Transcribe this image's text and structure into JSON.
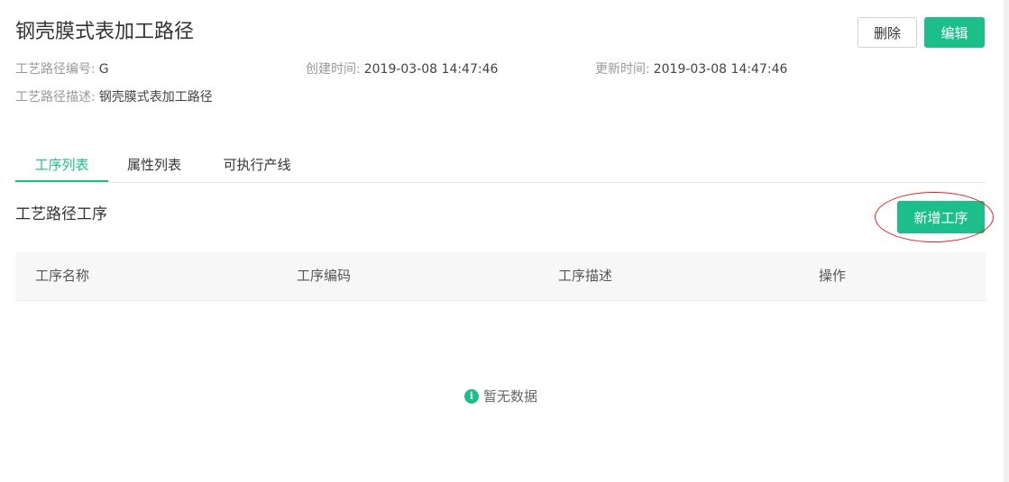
{
  "header": {
    "title": "钢壳膜式表加工路径",
    "delete_label": "删除",
    "edit_label": "编辑"
  },
  "meta": {
    "code_label": "工艺路径编号:",
    "code_value": "G",
    "created_label": "创建时间:",
    "created_value": "2019-03-08 14:47:46",
    "updated_label": "更新时间:",
    "updated_value": "2019-03-08 14:47:46",
    "desc_label": "工艺路径描述:",
    "desc_value": "钢壳膜式表加工路径"
  },
  "tabs": [
    {
      "label": "工序列表",
      "active": true
    },
    {
      "label": "属性列表",
      "active": false
    },
    {
      "label": "可执行产线",
      "active": false
    }
  ],
  "section": {
    "title": "工艺路径工序",
    "add_label": "新增工序"
  },
  "table": {
    "columns": [
      "工序名称",
      "工序编码",
      "工序描述",
      "操作"
    ],
    "rows": [],
    "empty_text": "暂无数据"
  },
  "icons": {
    "empty": "info-icon"
  },
  "colors": {
    "primary": "#1cbf8a",
    "highlight": "#e02020"
  }
}
